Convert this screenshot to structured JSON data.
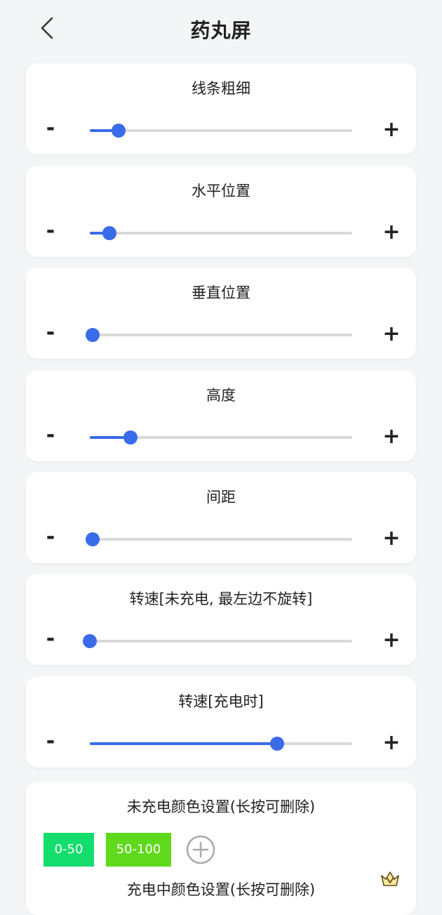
{
  "header": {
    "title": "药丸屏",
    "back_icon": "chevron-left-icon"
  },
  "sliders": [
    {
      "key": "line-width",
      "label": "线条粗细",
      "minus": "-",
      "plus": "+",
      "fraction": 0.11
    },
    {
      "key": "horizontal-position",
      "label": "水平位置",
      "minus": "-",
      "plus": "+",
      "fraction": 0.075
    },
    {
      "key": "vertical-position",
      "label": "垂直位置",
      "minus": "-",
      "plus": "+",
      "fraction": 0.01
    },
    {
      "key": "height",
      "label": "高度",
      "minus": "-",
      "plus": "+",
      "fraction": 0.155
    },
    {
      "key": "spacing",
      "label": "间距",
      "minus": "-",
      "plus": "+",
      "fraction": 0.01
    },
    {
      "key": "speed-not-charging",
      "label": "转速[未充电, 最左边不旋转]",
      "minus": "-",
      "plus": "+",
      "fraction": 0.0
    },
    {
      "key": "speed-charging",
      "label": "转速[充电时]",
      "minus": "-",
      "plus": "+",
      "fraction": 0.715
    }
  ],
  "colors": {
    "accent": "#3a6be8",
    "track": "#d9d9d9",
    "chip_0_50": "#13dd6d",
    "chip_50_100": "#5fd91b"
  },
  "color_settings": {
    "not_charging_title": "未充电颜色设置(长按可删除)",
    "chips": [
      {
        "label": "0-50",
        "color": "#13dd6d"
      },
      {
        "label": "50-100",
        "color": "#5fd91b"
      }
    ],
    "add_icon": "plus-circle-icon",
    "charging_title": "充电中颜色设置(长按可删除)",
    "premium_icon": "crown-icon"
  }
}
